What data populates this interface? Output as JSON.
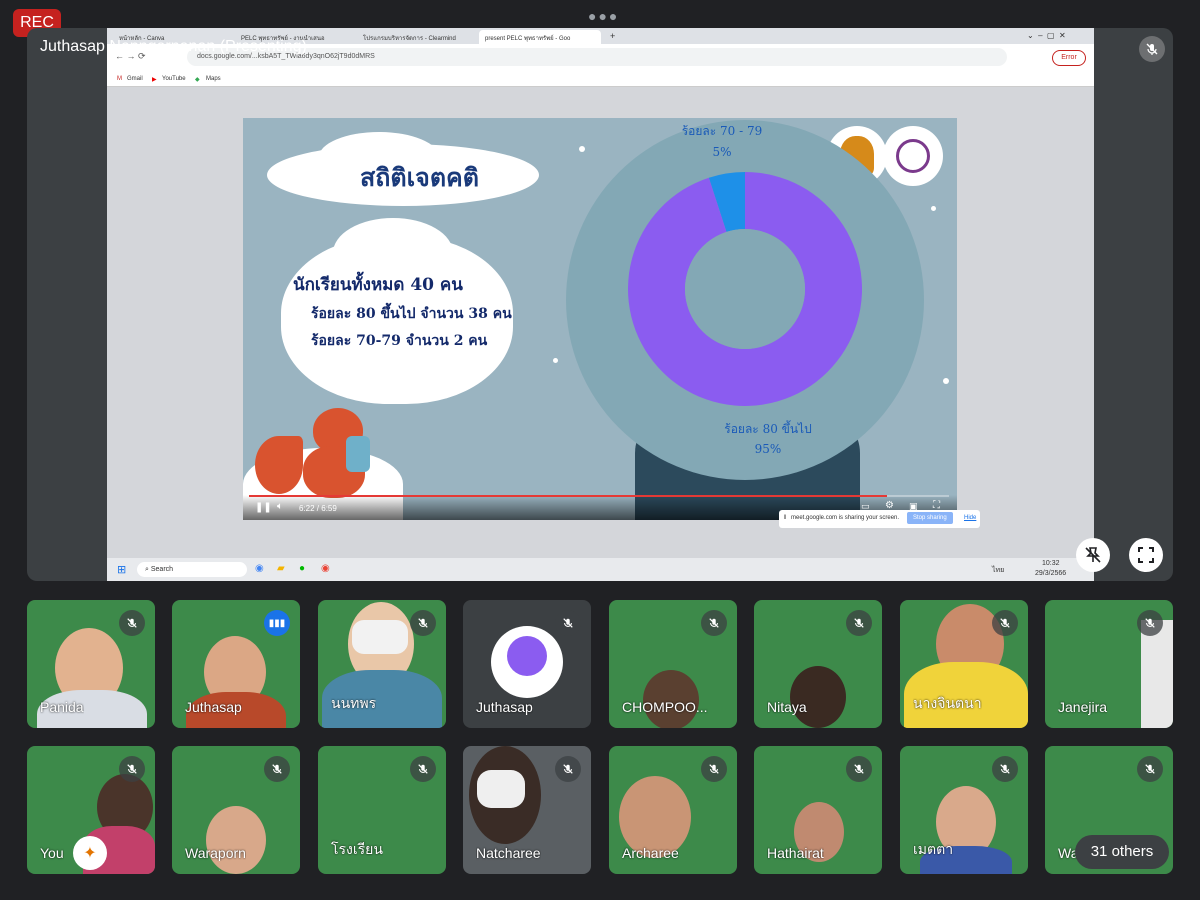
{
  "recording": {
    "label": "REC"
  },
  "presenter": {
    "label": "Juthasap Napngernanan (Presenting)"
  },
  "browser": {
    "tabs": [
      "หน้าหลัก - Canva",
      "PELC พุทธาทรัพย์ - งานนำเสนอ",
      "โปรแกรมบริหารจัดการ - Clearmind",
      "present PELC พุทธาทรัพย์ - Goo"
    ],
    "url": "docs.google.com/...ksbA5T_TWia6dy3qnO62jT9d0dMRS",
    "error_badge": "Error",
    "bookmarks": [
      "Gmail",
      "YouTube",
      "Maps"
    ],
    "share_notice": "meet.google.com is sharing your screen.",
    "stop_sharing": "Stop sharing",
    "hide": "Hide"
  },
  "slide": {
    "title": "สถิติเจตคติ",
    "line1": "นักเรียนทั้งหมด  40  คน",
    "line2": "ร้อยละ 80 ขึ้นไป จำนวน 38 คน",
    "line3": "ร้อยละ 70-79     จำนวน  2 คน",
    "video_time": "6:22 / 6:59",
    "video_progress": 0.911
  },
  "chart_data": {
    "type": "pie",
    "donut": true,
    "slices": [
      {
        "label": "ร้อยละ 80 ขึ้นไป",
        "value": 95,
        "value_label": "95%",
        "color": "#8b5cf0"
      },
      {
        "label": "ร้อยละ 70 - 79",
        "value": 5,
        "value_label": "5%",
        "color": "#1e90e8"
      }
    ]
  },
  "taskbar": {
    "search": "Search",
    "time": "10:32",
    "date": "29/3/2566",
    "lang": "ไทย"
  },
  "participants_row1": [
    {
      "name": "Panida",
      "mode": "video"
    },
    {
      "name": "Juthasap",
      "mode": "video",
      "speaking": true
    },
    {
      "name": "นนทพร",
      "mode": "video"
    },
    {
      "name": "Juthasap",
      "mode": "avatar"
    },
    {
      "name": "CHOMPOO...",
      "mode": "video"
    },
    {
      "name": "Nitaya",
      "mode": "video"
    },
    {
      "name": "นางจินตนา",
      "mode": "video"
    },
    {
      "name": "Janejira",
      "mode": "video"
    }
  ],
  "participants_row2": [
    {
      "name": "You",
      "mode": "video"
    },
    {
      "name": "Waraporn",
      "mode": "video"
    },
    {
      "name": "โรงเรียน",
      "mode": "video"
    },
    {
      "name": "Natcharee",
      "mode": "video"
    },
    {
      "name": "Archaree",
      "mode": "video"
    },
    {
      "name": "Hathairat",
      "mode": "video"
    },
    {
      "name": "เมตตา",
      "mode": "video"
    },
    {
      "name": "Wa",
      "mode": "video"
    }
  ],
  "others": {
    "label": "31 others"
  },
  "colors": {
    "accent": "#1a73e8",
    "rec": "#c5221f",
    "tile_green": "#3d8a4a"
  }
}
